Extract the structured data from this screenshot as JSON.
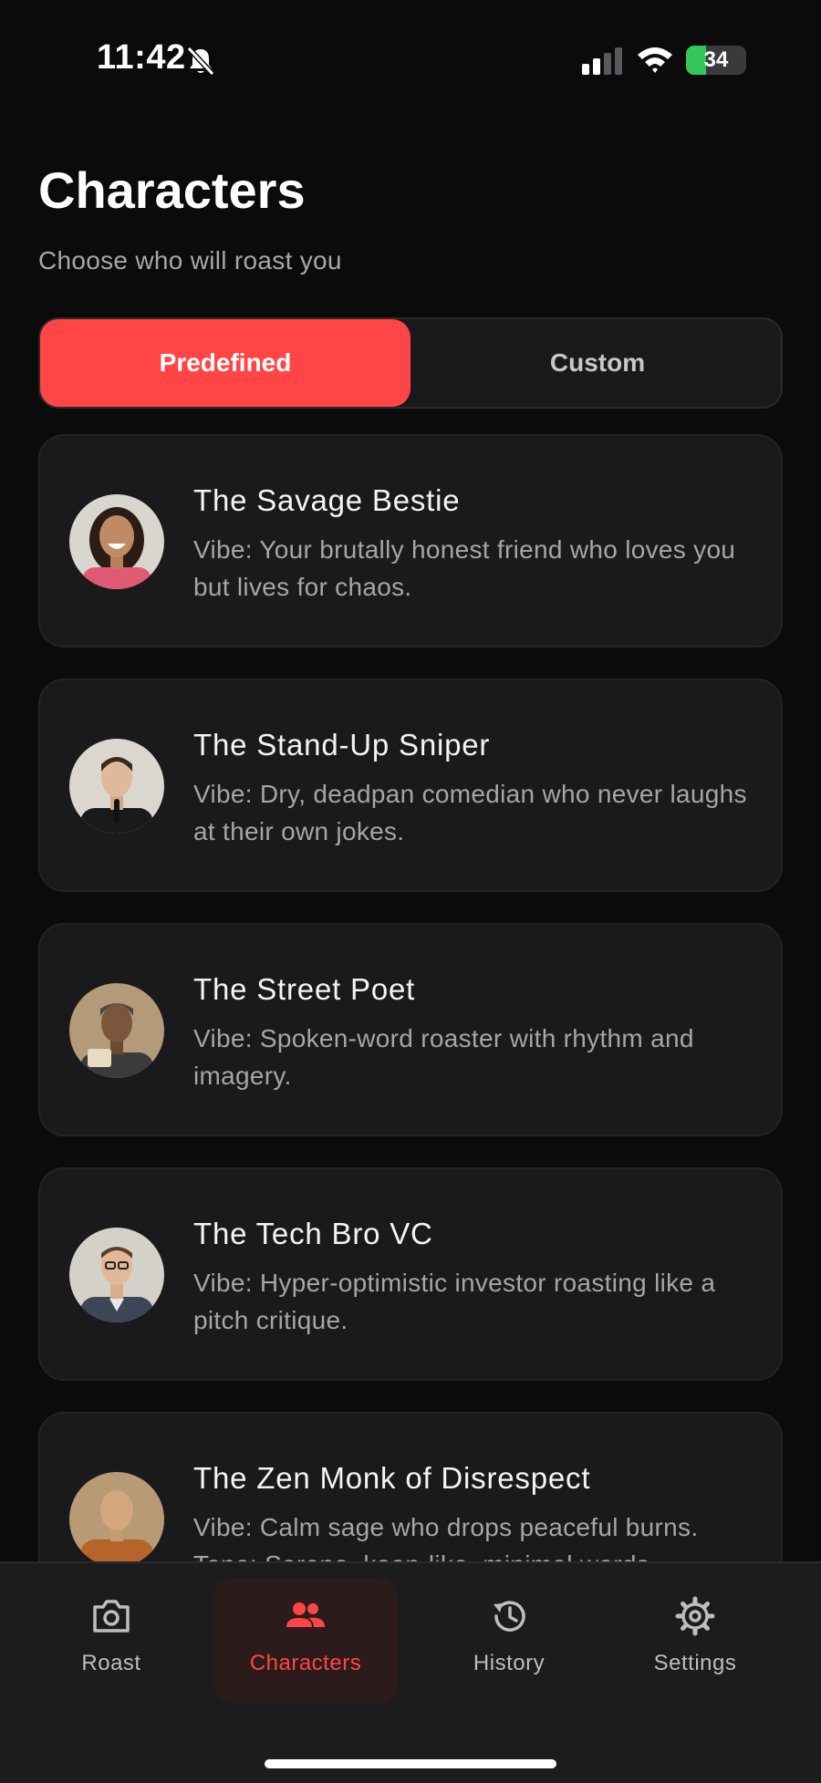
{
  "status": {
    "time": "11:42",
    "battery": "34",
    "battery_level": 0.34
  },
  "header": {
    "title": "Characters",
    "subtitle": "Choose who will roast you"
  },
  "segments": {
    "predefined": "Predefined",
    "custom": "Custom",
    "selected": "Predefined"
  },
  "characters": [
    {
      "name": "The Savage Bestie",
      "desc": "Vibe: Your brutally honest friend who loves you but lives for chaos."
    },
    {
      "name": "The Stand-Up Sniper",
      "desc": "Vibe: Dry, deadpan comedian who never laughs at their own jokes."
    },
    {
      "name": "The Street Poet",
      "desc": "Vibe: Spoken-word roaster with rhythm and imagery."
    },
    {
      "name": "The Tech Bro VC",
      "desc": "Vibe: Hyper-optimistic investor roasting like a pitch critique."
    },
    {
      "name": "The Zen Monk of Disrespect",
      "desc": "Vibe: Calm sage who drops peaceful burns. Tone: Serene, koan-like, minimal words."
    }
  ],
  "tabs": {
    "roast": "Roast",
    "characters": "Characters",
    "history": "History",
    "settings": "Settings",
    "active": "Characters"
  },
  "colors": {
    "accent": "#ff4545",
    "background": "#0b0b0c",
    "card": "#1a1a1c",
    "battery": "#34c759"
  }
}
